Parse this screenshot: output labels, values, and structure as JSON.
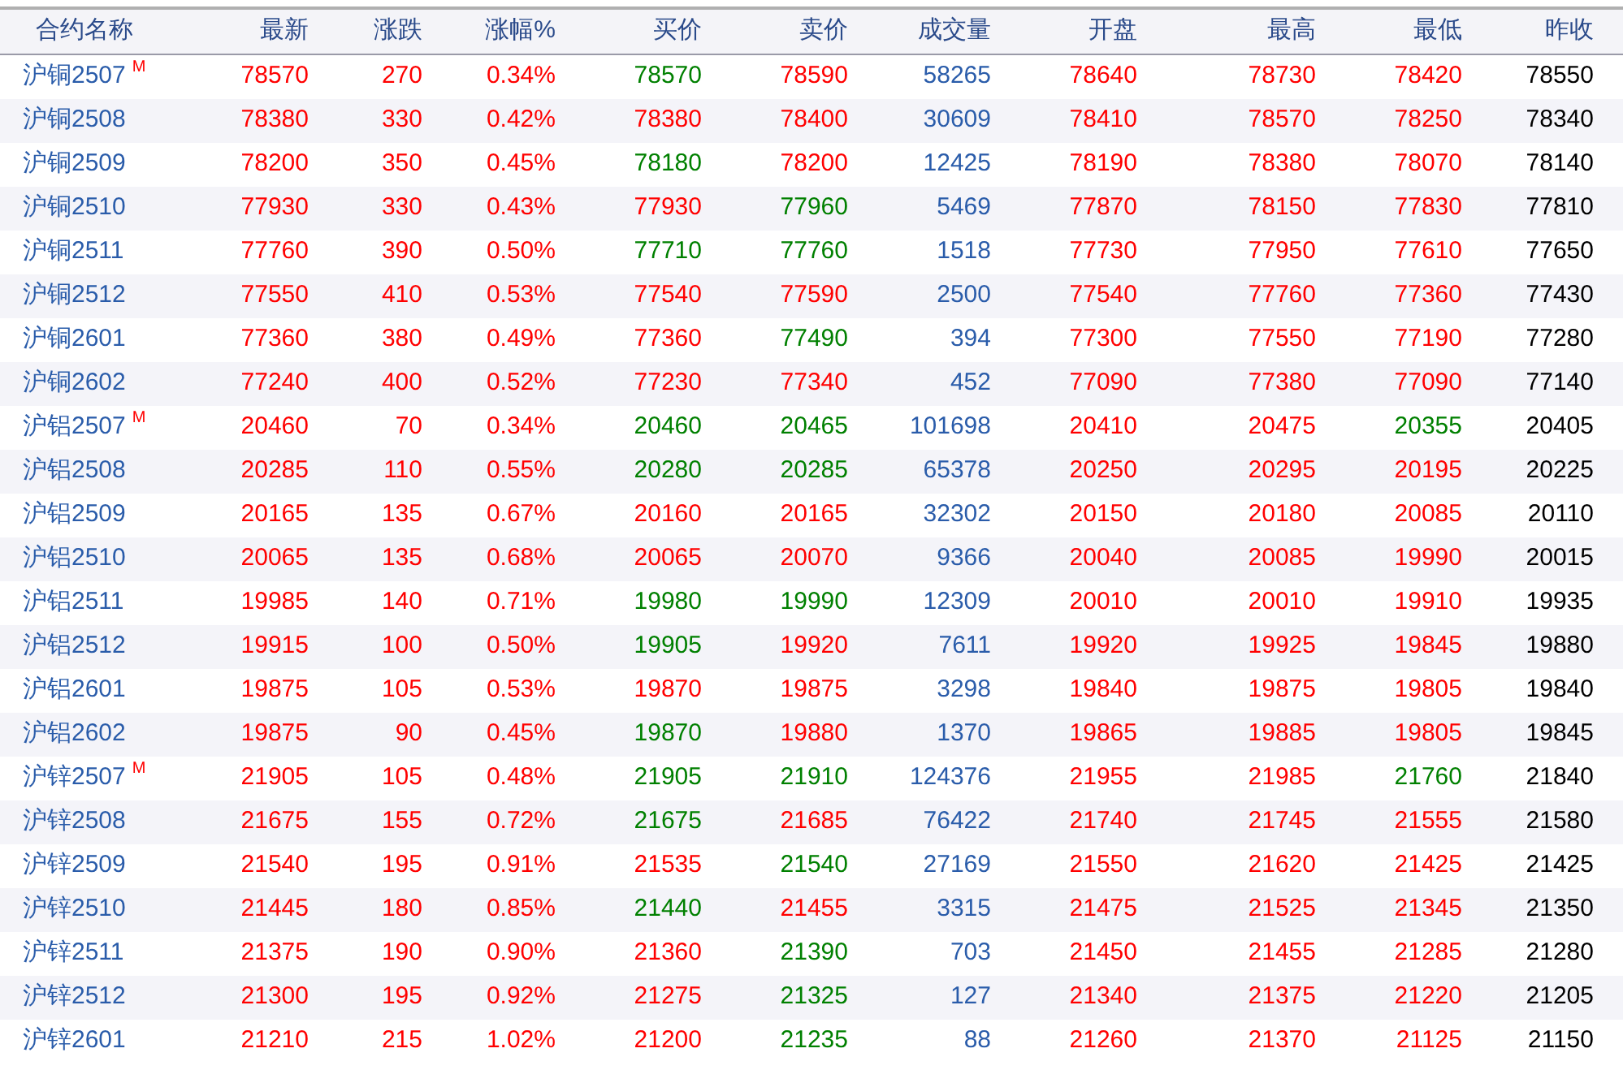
{
  "table": {
    "columns": [
      "合约名称",
      "最新",
      "涨跌",
      "涨幅%",
      "买价",
      "卖价",
      "成交量",
      "开盘",
      "最高",
      "最低",
      "昨收"
    ],
    "rows": [
      {
        "badge": "M",
        "cells": [
          {
            "text": "沪铜2507",
            "color": "#2a5caa"
          },
          {
            "text": "78570",
            "color": "#ff0000"
          },
          {
            "text": "270",
            "color": "#ff0000"
          },
          {
            "text": "0.34%",
            "color": "#ff0000"
          },
          {
            "text": "78570",
            "color": "#008000"
          },
          {
            "text": "78590",
            "color": "#ff0000"
          },
          {
            "text": "58265",
            "color": "#2a5caa"
          },
          {
            "text": "78640",
            "color": "#ff0000"
          },
          {
            "text": "78730",
            "color": "#ff0000"
          },
          {
            "text": "78420",
            "color": "#ff0000"
          },
          {
            "text": "78550",
            "color": "#000000"
          }
        ]
      },
      {
        "cells": [
          {
            "text": "沪铜2508",
            "color": "#2a5caa"
          },
          {
            "text": "78380",
            "color": "#ff0000"
          },
          {
            "text": "330",
            "color": "#ff0000"
          },
          {
            "text": "0.42%",
            "color": "#ff0000"
          },
          {
            "text": "78380",
            "color": "#ff0000"
          },
          {
            "text": "78400",
            "color": "#ff0000"
          },
          {
            "text": "30609",
            "color": "#2a5caa"
          },
          {
            "text": "78410",
            "color": "#ff0000"
          },
          {
            "text": "78570",
            "color": "#ff0000"
          },
          {
            "text": "78250",
            "color": "#ff0000"
          },
          {
            "text": "78340",
            "color": "#000000"
          }
        ]
      },
      {
        "cells": [
          {
            "text": "沪铜2509",
            "color": "#2a5caa"
          },
          {
            "text": "78200",
            "color": "#ff0000"
          },
          {
            "text": "350",
            "color": "#ff0000"
          },
          {
            "text": "0.45%",
            "color": "#ff0000"
          },
          {
            "text": "78180",
            "color": "#008000"
          },
          {
            "text": "78200",
            "color": "#ff0000"
          },
          {
            "text": "12425",
            "color": "#2a5caa"
          },
          {
            "text": "78190",
            "color": "#ff0000"
          },
          {
            "text": "78380",
            "color": "#ff0000"
          },
          {
            "text": "78070",
            "color": "#ff0000"
          },
          {
            "text": "78140",
            "color": "#000000"
          }
        ]
      },
      {
        "cells": [
          {
            "text": "沪铜2510",
            "color": "#2a5caa"
          },
          {
            "text": "77930",
            "color": "#ff0000"
          },
          {
            "text": "330",
            "color": "#ff0000"
          },
          {
            "text": "0.43%",
            "color": "#ff0000"
          },
          {
            "text": "77930",
            "color": "#ff0000"
          },
          {
            "text": "77960",
            "color": "#008000"
          },
          {
            "text": "5469",
            "color": "#2a5caa"
          },
          {
            "text": "77870",
            "color": "#ff0000"
          },
          {
            "text": "78150",
            "color": "#ff0000"
          },
          {
            "text": "77830",
            "color": "#ff0000"
          },
          {
            "text": "77810",
            "color": "#000000"
          }
        ]
      },
      {
        "cells": [
          {
            "text": "沪铜2511",
            "color": "#2a5caa"
          },
          {
            "text": "77760",
            "color": "#ff0000"
          },
          {
            "text": "390",
            "color": "#ff0000"
          },
          {
            "text": "0.50%",
            "color": "#ff0000"
          },
          {
            "text": "77710",
            "color": "#008000"
          },
          {
            "text": "77760",
            "color": "#008000"
          },
          {
            "text": "1518",
            "color": "#2a5caa"
          },
          {
            "text": "77730",
            "color": "#ff0000"
          },
          {
            "text": "77950",
            "color": "#ff0000"
          },
          {
            "text": "77610",
            "color": "#ff0000"
          },
          {
            "text": "77650",
            "color": "#000000"
          }
        ]
      },
      {
        "cells": [
          {
            "text": "沪铜2512",
            "color": "#2a5caa"
          },
          {
            "text": "77550",
            "color": "#ff0000"
          },
          {
            "text": "410",
            "color": "#ff0000"
          },
          {
            "text": "0.53%",
            "color": "#ff0000"
          },
          {
            "text": "77540",
            "color": "#ff0000"
          },
          {
            "text": "77590",
            "color": "#ff0000"
          },
          {
            "text": "2500",
            "color": "#2a5caa"
          },
          {
            "text": "77540",
            "color": "#ff0000"
          },
          {
            "text": "77760",
            "color": "#ff0000"
          },
          {
            "text": "77360",
            "color": "#ff0000"
          },
          {
            "text": "77430",
            "color": "#000000"
          }
        ]
      },
      {
        "cells": [
          {
            "text": "沪铜2601",
            "color": "#2a5caa"
          },
          {
            "text": "77360",
            "color": "#ff0000"
          },
          {
            "text": "380",
            "color": "#ff0000"
          },
          {
            "text": "0.49%",
            "color": "#ff0000"
          },
          {
            "text": "77360",
            "color": "#ff0000"
          },
          {
            "text": "77490",
            "color": "#008000"
          },
          {
            "text": "394",
            "color": "#2a5caa"
          },
          {
            "text": "77300",
            "color": "#ff0000"
          },
          {
            "text": "77550",
            "color": "#ff0000"
          },
          {
            "text": "77190",
            "color": "#ff0000"
          },
          {
            "text": "77280",
            "color": "#000000"
          }
        ]
      },
      {
        "cells": [
          {
            "text": "沪铜2602",
            "color": "#2a5caa"
          },
          {
            "text": "77240",
            "color": "#ff0000"
          },
          {
            "text": "400",
            "color": "#ff0000"
          },
          {
            "text": "0.52%",
            "color": "#ff0000"
          },
          {
            "text": "77230",
            "color": "#ff0000"
          },
          {
            "text": "77340",
            "color": "#ff0000"
          },
          {
            "text": "452",
            "color": "#2a5caa"
          },
          {
            "text": "77090",
            "color": "#ff0000"
          },
          {
            "text": "77380",
            "color": "#ff0000"
          },
          {
            "text": "77090",
            "color": "#ff0000"
          },
          {
            "text": "77140",
            "color": "#000000"
          }
        ]
      },
      {
        "badge": "M",
        "cells": [
          {
            "text": "沪铝2507",
            "color": "#2a5caa"
          },
          {
            "text": "20460",
            "color": "#ff0000"
          },
          {
            "text": "70",
            "color": "#ff0000"
          },
          {
            "text": "0.34%",
            "color": "#ff0000"
          },
          {
            "text": "20460",
            "color": "#008000"
          },
          {
            "text": "20465",
            "color": "#008000"
          },
          {
            "text": "101698",
            "color": "#2a5caa"
          },
          {
            "text": "20410",
            "color": "#ff0000"
          },
          {
            "text": "20475",
            "color": "#ff0000"
          },
          {
            "text": "20355",
            "color": "#008000"
          },
          {
            "text": "20405",
            "color": "#000000"
          }
        ]
      },
      {
        "cells": [
          {
            "text": "沪铝2508",
            "color": "#2a5caa"
          },
          {
            "text": "20285",
            "color": "#ff0000"
          },
          {
            "text": "110",
            "color": "#ff0000"
          },
          {
            "text": "0.55%",
            "color": "#ff0000"
          },
          {
            "text": "20280",
            "color": "#008000"
          },
          {
            "text": "20285",
            "color": "#008000"
          },
          {
            "text": "65378",
            "color": "#2a5caa"
          },
          {
            "text": "20250",
            "color": "#ff0000"
          },
          {
            "text": "20295",
            "color": "#ff0000"
          },
          {
            "text": "20195",
            "color": "#ff0000"
          },
          {
            "text": "20225",
            "color": "#000000"
          }
        ]
      },
      {
        "cells": [
          {
            "text": "沪铝2509",
            "color": "#2a5caa"
          },
          {
            "text": "20165",
            "color": "#ff0000"
          },
          {
            "text": "135",
            "color": "#ff0000"
          },
          {
            "text": "0.67%",
            "color": "#ff0000"
          },
          {
            "text": "20160",
            "color": "#ff0000"
          },
          {
            "text": "20165",
            "color": "#ff0000"
          },
          {
            "text": "32302",
            "color": "#2a5caa"
          },
          {
            "text": "20150",
            "color": "#ff0000"
          },
          {
            "text": "20180",
            "color": "#ff0000"
          },
          {
            "text": "20085",
            "color": "#ff0000"
          },
          {
            "text": "20110",
            "color": "#000000"
          }
        ]
      },
      {
        "cells": [
          {
            "text": "沪铝2510",
            "color": "#2a5caa"
          },
          {
            "text": "20065",
            "color": "#ff0000"
          },
          {
            "text": "135",
            "color": "#ff0000"
          },
          {
            "text": "0.68%",
            "color": "#ff0000"
          },
          {
            "text": "20065",
            "color": "#ff0000"
          },
          {
            "text": "20070",
            "color": "#ff0000"
          },
          {
            "text": "9366",
            "color": "#2a5caa"
          },
          {
            "text": "20040",
            "color": "#ff0000"
          },
          {
            "text": "20085",
            "color": "#ff0000"
          },
          {
            "text": "19990",
            "color": "#ff0000"
          },
          {
            "text": "20015",
            "color": "#000000"
          }
        ]
      },
      {
        "cells": [
          {
            "text": "沪铝2511",
            "color": "#2a5caa"
          },
          {
            "text": "19985",
            "color": "#ff0000"
          },
          {
            "text": "140",
            "color": "#ff0000"
          },
          {
            "text": "0.71%",
            "color": "#ff0000"
          },
          {
            "text": "19980",
            "color": "#008000"
          },
          {
            "text": "19990",
            "color": "#008000"
          },
          {
            "text": "12309",
            "color": "#2a5caa"
          },
          {
            "text": "20010",
            "color": "#ff0000"
          },
          {
            "text": "20010",
            "color": "#ff0000"
          },
          {
            "text": "19910",
            "color": "#ff0000"
          },
          {
            "text": "19935",
            "color": "#000000"
          }
        ]
      },
      {
        "cells": [
          {
            "text": "沪铝2512",
            "color": "#2a5caa"
          },
          {
            "text": "19915",
            "color": "#ff0000"
          },
          {
            "text": "100",
            "color": "#ff0000"
          },
          {
            "text": "0.50%",
            "color": "#ff0000"
          },
          {
            "text": "19905",
            "color": "#008000"
          },
          {
            "text": "19920",
            "color": "#ff0000"
          },
          {
            "text": "7611",
            "color": "#2a5caa"
          },
          {
            "text": "19920",
            "color": "#ff0000"
          },
          {
            "text": "19925",
            "color": "#ff0000"
          },
          {
            "text": "19845",
            "color": "#ff0000"
          },
          {
            "text": "19880",
            "color": "#000000"
          }
        ]
      },
      {
        "cells": [
          {
            "text": "沪铝2601",
            "color": "#2a5caa"
          },
          {
            "text": "19875",
            "color": "#ff0000"
          },
          {
            "text": "105",
            "color": "#ff0000"
          },
          {
            "text": "0.53%",
            "color": "#ff0000"
          },
          {
            "text": "19870",
            "color": "#ff0000"
          },
          {
            "text": "19875",
            "color": "#ff0000"
          },
          {
            "text": "3298",
            "color": "#2a5caa"
          },
          {
            "text": "19840",
            "color": "#ff0000"
          },
          {
            "text": "19875",
            "color": "#ff0000"
          },
          {
            "text": "19805",
            "color": "#ff0000"
          },
          {
            "text": "19840",
            "color": "#000000"
          }
        ]
      },
      {
        "cells": [
          {
            "text": "沪铝2602",
            "color": "#2a5caa"
          },
          {
            "text": "19875",
            "color": "#ff0000"
          },
          {
            "text": "90",
            "color": "#ff0000"
          },
          {
            "text": "0.45%",
            "color": "#ff0000"
          },
          {
            "text": "19870",
            "color": "#008000"
          },
          {
            "text": "19880",
            "color": "#ff0000"
          },
          {
            "text": "1370",
            "color": "#2a5caa"
          },
          {
            "text": "19865",
            "color": "#ff0000"
          },
          {
            "text": "19885",
            "color": "#ff0000"
          },
          {
            "text": "19805",
            "color": "#ff0000"
          },
          {
            "text": "19845",
            "color": "#000000"
          }
        ]
      },
      {
        "badge": "M",
        "cells": [
          {
            "text": "沪锌2507",
            "color": "#2a5caa"
          },
          {
            "text": "21905",
            "color": "#ff0000"
          },
          {
            "text": "105",
            "color": "#ff0000"
          },
          {
            "text": "0.48%",
            "color": "#ff0000"
          },
          {
            "text": "21905",
            "color": "#008000"
          },
          {
            "text": "21910",
            "color": "#008000"
          },
          {
            "text": "124376",
            "color": "#2a5caa"
          },
          {
            "text": "21955",
            "color": "#ff0000"
          },
          {
            "text": "21985",
            "color": "#ff0000"
          },
          {
            "text": "21760",
            "color": "#008000"
          },
          {
            "text": "21840",
            "color": "#000000"
          }
        ]
      },
      {
        "cells": [
          {
            "text": "沪锌2508",
            "color": "#2a5caa"
          },
          {
            "text": "21675",
            "color": "#ff0000"
          },
          {
            "text": "155",
            "color": "#ff0000"
          },
          {
            "text": "0.72%",
            "color": "#ff0000"
          },
          {
            "text": "21675",
            "color": "#008000"
          },
          {
            "text": "21685",
            "color": "#ff0000"
          },
          {
            "text": "76422",
            "color": "#2a5caa"
          },
          {
            "text": "21740",
            "color": "#ff0000"
          },
          {
            "text": "21745",
            "color": "#ff0000"
          },
          {
            "text": "21555",
            "color": "#ff0000"
          },
          {
            "text": "21580",
            "color": "#000000"
          }
        ]
      },
      {
        "cells": [
          {
            "text": "沪锌2509",
            "color": "#2a5caa"
          },
          {
            "text": "21540",
            "color": "#ff0000"
          },
          {
            "text": "195",
            "color": "#ff0000"
          },
          {
            "text": "0.91%",
            "color": "#ff0000"
          },
          {
            "text": "21535",
            "color": "#ff0000"
          },
          {
            "text": "21540",
            "color": "#008000"
          },
          {
            "text": "27169",
            "color": "#2a5caa"
          },
          {
            "text": "21550",
            "color": "#ff0000"
          },
          {
            "text": "21620",
            "color": "#ff0000"
          },
          {
            "text": "21425",
            "color": "#ff0000"
          },
          {
            "text": "21425",
            "color": "#000000"
          }
        ]
      },
      {
        "cells": [
          {
            "text": "沪锌2510",
            "color": "#2a5caa"
          },
          {
            "text": "21445",
            "color": "#ff0000"
          },
          {
            "text": "180",
            "color": "#ff0000"
          },
          {
            "text": "0.85%",
            "color": "#ff0000"
          },
          {
            "text": "21440",
            "color": "#008000"
          },
          {
            "text": "21455",
            "color": "#ff0000"
          },
          {
            "text": "3315",
            "color": "#2a5caa"
          },
          {
            "text": "21475",
            "color": "#ff0000"
          },
          {
            "text": "21525",
            "color": "#ff0000"
          },
          {
            "text": "21345",
            "color": "#ff0000"
          },
          {
            "text": "21350",
            "color": "#000000"
          }
        ]
      },
      {
        "cells": [
          {
            "text": "沪锌2511",
            "color": "#2a5caa"
          },
          {
            "text": "21375",
            "color": "#ff0000"
          },
          {
            "text": "190",
            "color": "#ff0000"
          },
          {
            "text": "0.90%",
            "color": "#ff0000"
          },
          {
            "text": "21360",
            "color": "#ff0000"
          },
          {
            "text": "21390",
            "color": "#008000"
          },
          {
            "text": "703",
            "color": "#2a5caa"
          },
          {
            "text": "21450",
            "color": "#ff0000"
          },
          {
            "text": "21455",
            "color": "#ff0000"
          },
          {
            "text": "21285",
            "color": "#ff0000"
          },
          {
            "text": "21280",
            "color": "#000000"
          }
        ]
      },
      {
        "cells": [
          {
            "text": "沪锌2512",
            "color": "#2a5caa"
          },
          {
            "text": "21300",
            "color": "#ff0000"
          },
          {
            "text": "195",
            "color": "#ff0000"
          },
          {
            "text": "0.92%",
            "color": "#ff0000"
          },
          {
            "text": "21275",
            "color": "#ff0000"
          },
          {
            "text": "21325",
            "color": "#008000"
          },
          {
            "text": "127",
            "color": "#2a5caa"
          },
          {
            "text": "21340",
            "color": "#ff0000"
          },
          {
            "text": "21375",
            "color": "#ff0000"
          },
          {
            "text": "21220",
            "color": "#ff0000"
          },
          {
            "text": "21205",
            "color": "#000000"
          }
        ]
      },
      {
        "cells": [
          {
            "text": "沪锌2601",
            "color": "#2a5caa"
          },
          {
            "text": "21210",
            "color": "#ff0000"
          },
          {
            "text": "215",
            "color": "#ff0000"
          },
          {
            "text": "1.02%",
            "color": "#ff0000"
          },
          {
            "text": "21200",
            "color": "#ff0000"
          },
          {
            "text": "21235",
            "color": "#008000"
          },
          {
            "text": "88",
            "color": "#2a5caa"
          },
          {
            "text": "21260",
            "color": "#ff0000"
          },
          {
            "text": "21370",
            "color": "#ff0000"
          },
          {
            "text": "21125",
            "color": "#ff0000"
          },
          {
            "text": "21150",
            "color": "#000000"
          }
        ]
      }
    ]
  }
}
